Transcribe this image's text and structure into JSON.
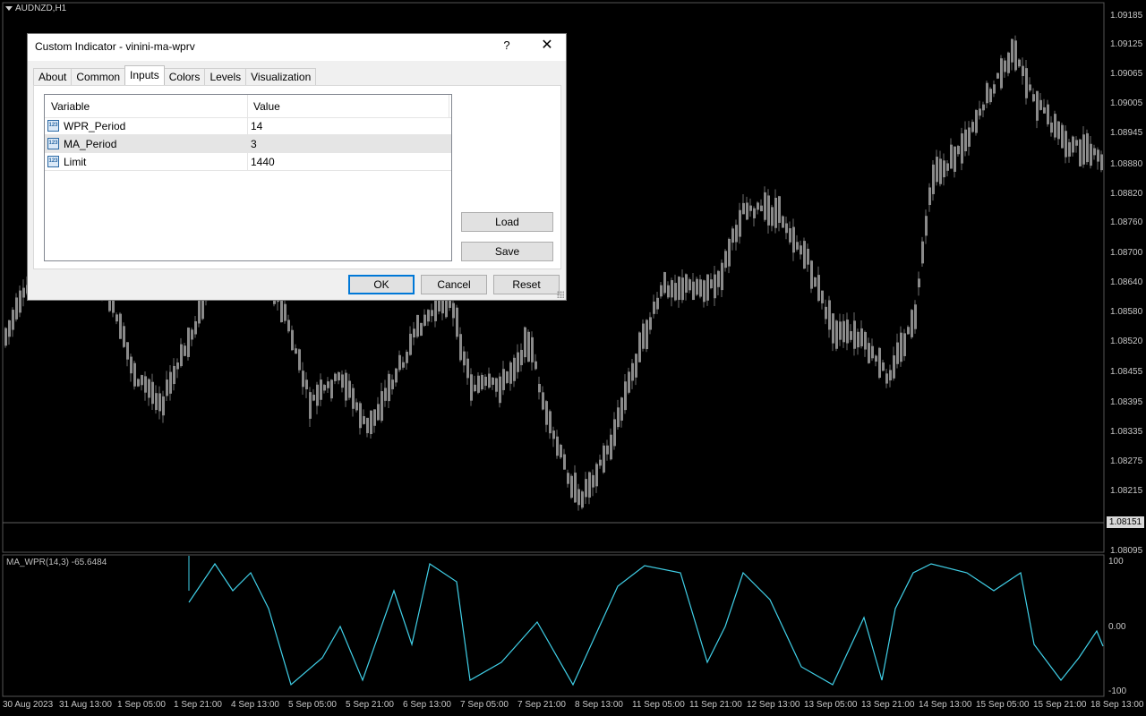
{
  "chart": {
    "symbol": "AUDNZD,H1",
    "indicator_label": "MA_WPR(14,3) -65.6484",
    "current_price": "1.08151",
    "price_axis": [
      "1.09185",
      "1.09125",
      "1.09065",
      "1.09005",
      "1.08945",
      "1.08880",
      "1.08820",
      "1.08760",
      "1.08700",
      "1.08640",
      "1.08580",
      "1.08520",
      "1.08455",
      "1.08395",
      "1.08335",
      "1.08275",
      "1.08215",
      "1.08095"
    ],
    "indicator_axis": [
      "100",
      "0.00",
      "-100"
    ],
    "time_axis": [
      "30 Aug 2023",
      "31 Aug 13:00",
      "1 Sep 05:00",
      "1 Sep 21:00",
      "4 Sep 13:00",
      "5 Sep 05:00",
      "5 Sep 21:00",
      "6 Sep 13:00",
      "7 Sep 05:00",
      "7 Sep 21:00",
      "8 Sep 13:00",
      "11 Sep 05:00",
      "11 Sep 21:00",
      "12 Sep 13:00",
      "13 Sep 05:00",
      "13 Sep 21:00",
      "14 Sep 13:00",
      "15 Sep 05:00",
      "15 Sep 21:00",
      "18 Sep 13:00"
    ],
    "colors": {
      "background": "#000000",
      "candles": "#8a8a8a",
      "indicator_line": "#40d0e8",
      "current_price_line": "#606060"
    }
  },
  "dialog": {
    "title": "Custom Indicator - vinini-ma-wprv",
    "help_label": "?",
    "close_label": "✕",
    "tabs": [
      "About",
      "Common",
      "Inputs",
      "Colors",
      "Levels",
      "Visualization"
    ],
    "active_tab": "Inputs",
    "grid": {
      "headers": [
        "Variable",
        "Value"
      ],
      "rows": [
        {
          "name": "WPR_Period",
          "value": "14",
          "icon": "123"
        },
        {
          "name": "MA_Period",
          "value": "3",
          "icon": "123"
        },
        {
          "name": "Limit",
          "value": "1440",
          "icon": "123"
        }
      ]
    },
    "load_label": "Load",
    "save_label": "Save",
    "ok_label": "OK",
    "cancel_label": "Cancel",
    "reset_label": "Reset"
  }
}
